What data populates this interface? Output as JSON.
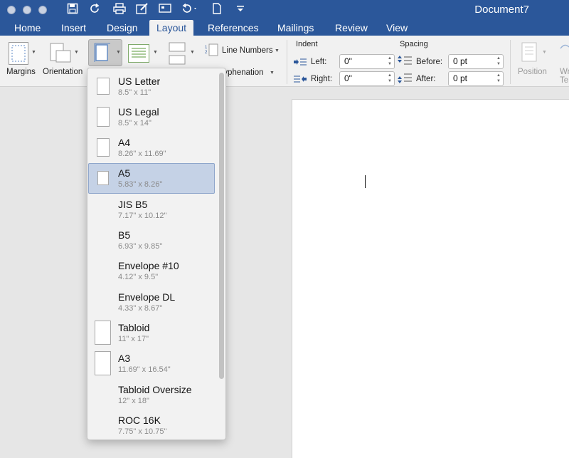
{
  "window": {
    "title": "Document7",
    "traffic_lights": [
      "close",
      "minimize",
      "zoom"
    ]
  },
  "quick_access": {
    "icons": [
      "save-icon",
      "redo-icon",
      "print-icon",
      "edit-icon",
      "comment-icon",
      "undo-icon",
      "new-document-icon",
      "customize-icon"
    ]
  },
  "tabs": [
    {
      "label": "Home"
    },
    {
      "label": "Insert"
    },
    {
      "label": "Design"
    },
    {
      "label": "Layout"
    },
    {
      "label": "References"
    },
    {
      "label": "Mailings"
    },
    {
      "label": "Review"
    },
    {
      "label": "View"
    }
  ],
  "active_tab": "Layout",
  "ribbon": {
    "margins_label": "Margins",
    "orientation_label": "Orientation",
    "line_numbers_label": "Line Numbers",
    "hyphenation_label": "Hyphenation",
    "indent": {
      "title": "Indent",
      "left_label": "Left:",
      "left_value": "0\"",
      "right_label": "Right:",
      "right_value": "0\""
    },
    "spacing": {
      "title": "Spacing",
      "before_label": "Before:",
      "before_value": "0 pt",
      "after_label": "After:",
      "after_value": "0 pt"
    },
    "position_label": "Position",
    "wrap_text_label": "Wr\nTe"
  },
  "size_menu": {
    "items": [
      {
        "name": "US Letter",
        "size": "8.5\" x 11\"",
        "selected": false
      },
      {
        "name": "US Legal",
        "size": "8.5\" x 14\"",
        "selected": false
      },
      {
        "name": "A4",
        "size": "8.26\" x 11.69\"",
        "selected": false
      },
      {
        "name": "A5",
        "size": "5.83\" x 8.26\"",
        "selected": true
      },
      {
        "name": "JIS B5",
        "size": "7.17\" x 10.12\"",
        "selected": false
      },
      {
        "name": "B5",
        "size": "6.93\" x 9.85\"",
        "selected": false
      },
      {
        "name": "Envelope #10",
        "size": "4.12\" x 9.5\"",
        "selected": false
      },
      {
        "name": "Envelope DL",
        "size": "4.33\" x 8.67\"",
        "selected": false
      },
      {
        "name": "Tabloid",
        "size": "11\" x 17\"",
        "selected": false
      },
      {
        "name": "A3",
        "size": "11.69\" x 16.54\"",
        "selected": false
      },
      {
        "name": "Tabloid Oversize",
        "size": "12\" x 18\"",
        "selected": false
      },
      {
        "name": "ROC 16K",
        "size": "7.75\" x 10.75\"",
        "selected": false
      }
    ]
  },
  "colors": {
    "title_bar": "#2b579a",
    "selection": "#c5d2e6"
  }
}
